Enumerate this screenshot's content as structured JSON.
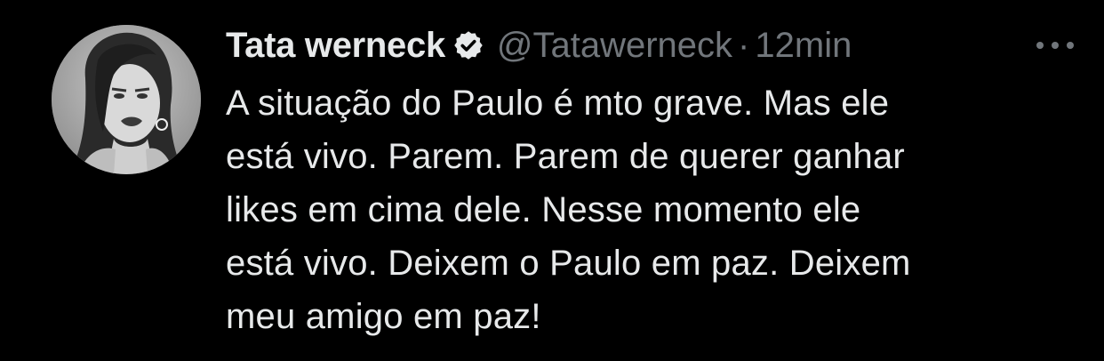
{
  "tweet": {
    "display_name": "Tata werneck",
    "handle": "@Tatawerneck",
    "separator": "·",
    "time": "12min",
    "text": "A situação do Paulo é mto grave. Mas ele\nestá vivo. Parem. Parem de querer ganhar\nlikes em cima dele. Nesse momento ele\nestá vivo. Deixem o Paulo em paz. Deixem\nmeu amigo em paz!",
    "verified_icon": "verified-badge-icon",
    "more_icon": "more-horizontal-icon"
  },
  "colors": {
    "background": "#000000",
    "primary_text": "#e7e9ea",
    "secondary_text": "#71767b"
  }
}
